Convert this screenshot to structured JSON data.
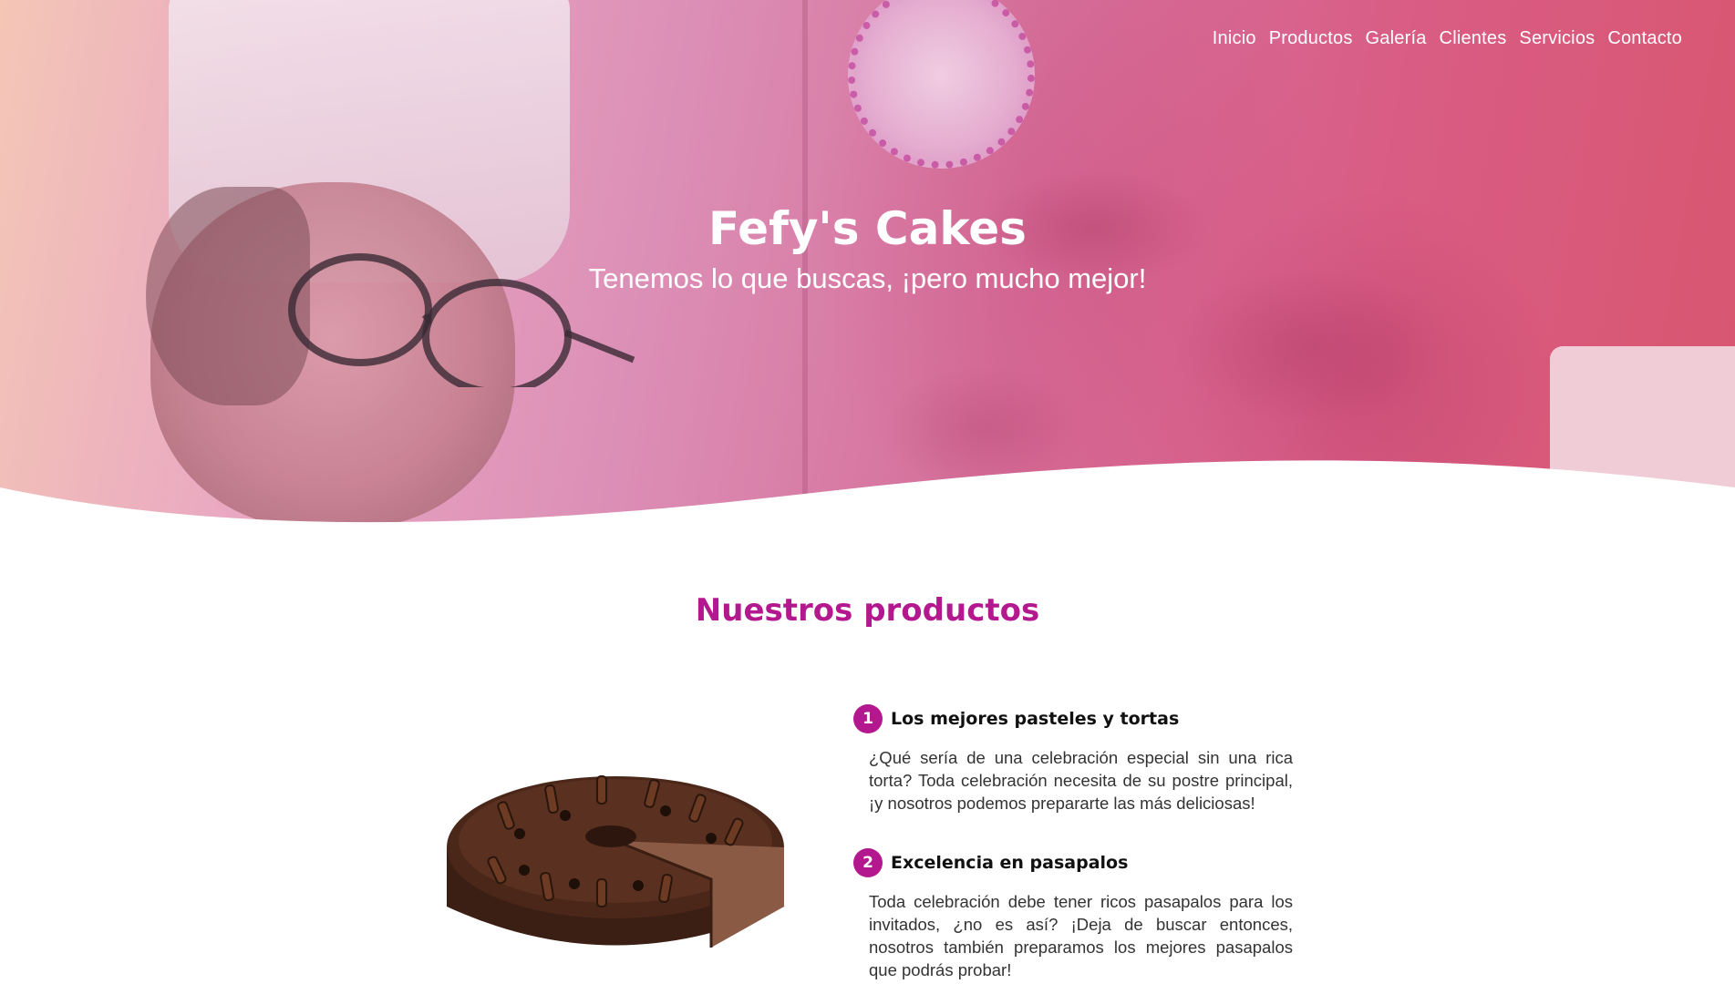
{
  "nav": {
    "items": [
      {
        "label": "Inicio"
      },
      {
        "label": "Productos"
      },
      {
        "label": "Galería"
      },
      {
        "label": "Clientes"
      },
      {
        "label": "Servicios"
      },
      {
        "label": "Contacto"
      }
    ]
  },
  "hero": {
    "title": "Fefy's Cakes",
    "subtitle": "Tenemos lo que buscas, ¡pero mucho mejor!"
  },
  "products": {
    "title": "Nuestros productos",
    "items": [
      {
        "number": "1",
        "title": "Los mejores pasteles y tortas",
        "text": "¿Qué sería de una celebración especial sin una rica torta? Toda celebración necesita de su postre principal, ¡y nosotros podemos prepararte las más deliciosas!"
      },
      {
        "number": "2",
        "title": "Excelencia en pasapalos",
        "text": "Toda celebración debe tener ricos pasapalos para los invitados, ¿no es así? ¡Deja de buscar entonces, nosotros también preparamos los mejores pasapalos que podrás probar!"
      }
    ]
  },
  "colors": {
    "accent": "#b4188e",
    "hero_gradient_start": "#f4c6b6",
    "hero_gradient_end": "#d8566f"
  },
  "icons": {
    "cake_image": "chocolate-cake-image",
    "hero_photo": "chef-photo-background"
  }
}
